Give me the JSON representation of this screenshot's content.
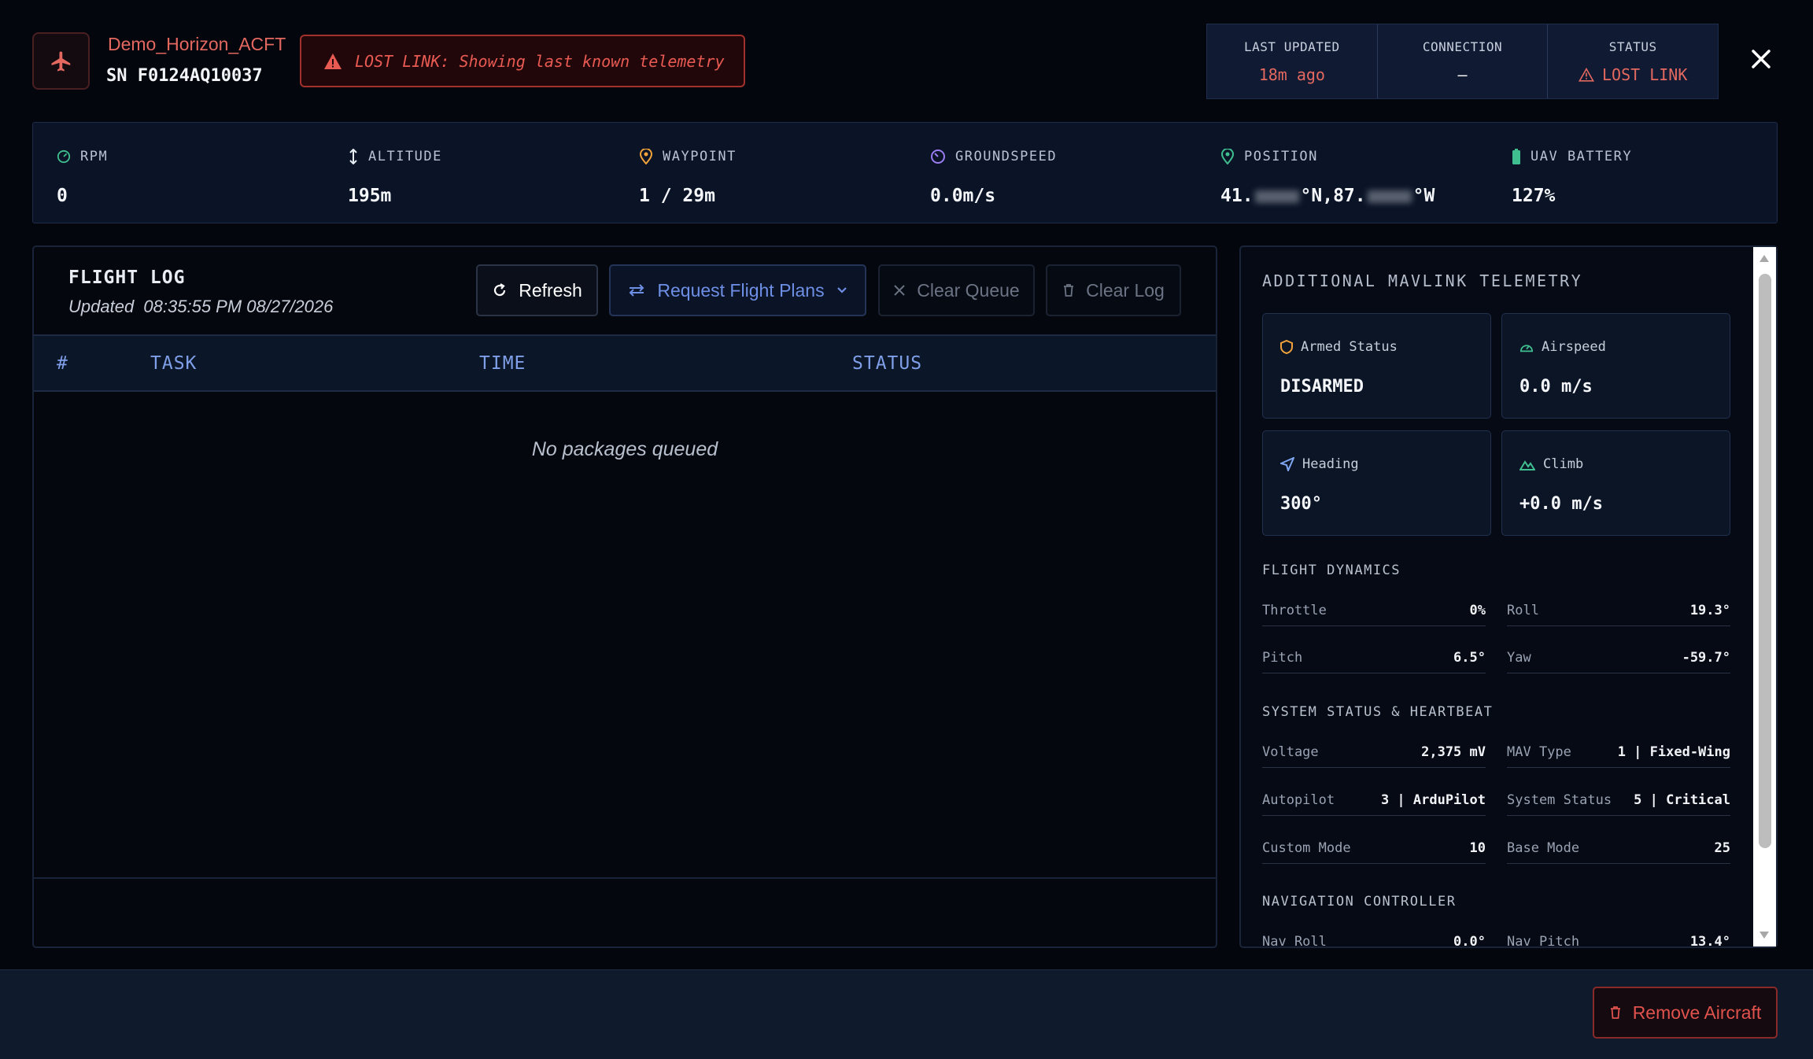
{
  "header": {
    "aircraft_name": "Demo_Horizon_ACFT",
    "serial": "SN F0124AQ10037",
    "lost_link_banner": "LOST LINK: Showing last known telemetry",
    "status_boxes": {
      "last_updated": {
        "label": "LAST UPDATED",
        "value": "18m ago"
      },
      "connection": {
        "label": "CONNECTION",
        "value": "–"
      },
      "status": {
        "label": "STATUS",
        "value": "LOST LINK"
      }
    },
    "close_icon": "close-icon"
  },
  "telemetry": {
    "rpm": {
      "label": "RPM",
      "value": "0"
    },
    "altitude": {
      "label": "ALTITUDE",
      "value": "195m"
    },
    "waypoint": {
      "label": "WAYPOINT",
      "value": "1 / 29m"
    },
    "groundspeed": {
      "label": "GROUNDSPEED",
      "value": "0.0m/s"
    },
    "position": {
      "label": "POSITION",
      "lat_prefix": "41.",
      "lat_suffix": "°N,87.",
      "lon_suffix": "°W"
    },
    "battery": {
      "label": "UAV BATTERY",
      "value": "127%"
    }
  },
  "flight_log": {
    "title": "FLIGHT LOG",
    "updated_label": "Updated",
    "updated_value": "08:35:55 PM 08/27/2026",
    "buttons": {
      "refresh": "Refresh",
      "request": "Request Flight Plans",
      "clear_queue": "Clear Queue",
      "clear_log": "Clear Log"
    },
    "columns": [
      "#",
      "TASK",
      "TIME",
      "STATUS"
    ],
    "empty_message": "No packages queued"
  },
  "mavlink": {
    "title": "ADDITIONAL MAVLINK TELEMETRY",
    "cards": {
      "armed": {
        "label": "Armed Status",
        "value": "DISARMED"
      },
      "airspeed": {
        "label": "Airspeed",
        "value": "0.0 m/s"
      },
      "heading": {
        "label": "Heading",
        "value": "300°"
      },
      "climb": {
        "label": "Climb",
        "value": "+0.0 m/s"
      }
    },
    "flight_dynamics": {
      "title": "FLIGHT DYNAMICS",
      "rows": [
        {
          "k1": "Throttle",
          "v1": "0%",
          "k2": "Roll",
          "v2": "19.3°"
        },
        {
          "k1": "Pitch",
          "v1": "6.5°",
          "k2": "Yaw",
          "v2": "-59.7°"
        }
      ]
    },
    "system_status": {
      "title": "SYSTEM STATUS & HEARTBEAT",
      "rows": [
        {
          "k1": "Voltage",
          "v1": "2,375 mV",
          "k2": "MAV Type",
          "v2": "1 | Fixed-Wing"
        },
        {
          "k1": "Autopilot",
          "v1": "3 | ArduPilot",
          "k2": "System Status",
          "v2": "5 | Critical"
        },
        {
          "k1": "Custom Mode",
          "v1": "10",
          "k2": "Base Mode",
          "v2": "25"
        }
      ]
    },
    "nav_controller": {
      "title": "NAVIGATION CONTROLLER",
      "rows": [
        {
          "k1": "Nav Roll",
          "v1": "0.0°",
          "k2": "Nav Pitch",
          "v2": "13.4°"
        }
      ]
    }
  },
  "footer": {
    "remove_button": "Remove Aircraft"
  },
  "colors": {
    "background": "#03060d",
    "alert_red": "#e3685f",
    "accent_blue": "#6e8fe6"
  }
}
